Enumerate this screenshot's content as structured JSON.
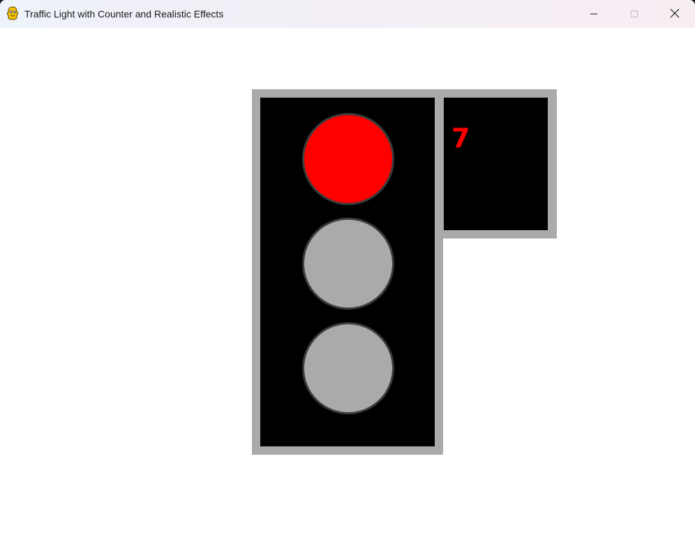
{
  "window": {
    "title": "Traffic Light with Counter and Realistic Effects",
    "app_icon": "pygame-snake-icon",
    "controls": {
      "minimize_icon": "minimize-icon",
      "maximize_icon": "maximize-icon",
      "close_icon": "close-icon"
    }
  },
  "traffic_light": {
    "active_light": "red",
    "housing_color": "#aaaaaa",
    "panel_color": "#000000",
    "lamp_border_color": "#3c3c3c",
    "lamps": [
      {
        "name": "red",
        "state": "on",
        "color": "#ff0000"
      },
      {
        "name": "yellow",
        "state": "off",
        "color": "#aaaaaa"
      },
      {
        "name": "green",
        "state": "off",
        "color": "#aaaaaa"
      }
    ]
  },
  "counter": {
    "value": "7",
    "color": "#ff0000"
  }
}
